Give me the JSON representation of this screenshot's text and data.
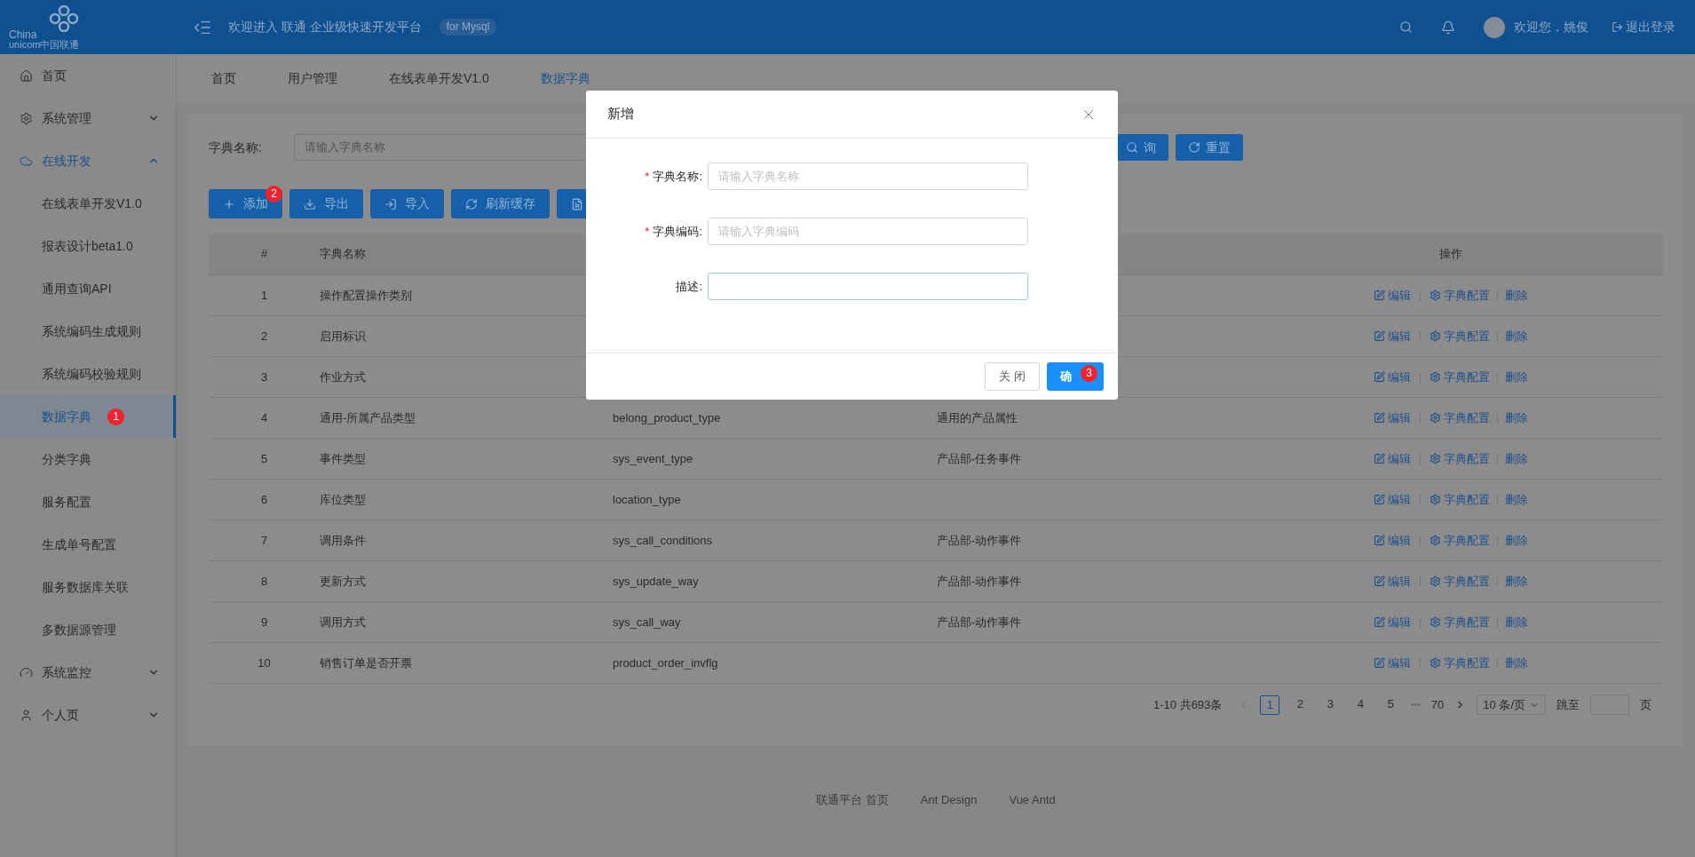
{
  "header": {
    "logo_lines": [
      "China",
      "unicom中国联通"
    ],
    "title": "欢迎进入 联通 企业级快速开发平台",
    "tag": "for Mysql",
    "greeting": "欢迎您，姚俊",
    "logout": "退出登录"
  },
  "sidebar": {
    "items": [
      {
        "label": "首页",
        "kind": "home",
        "selected": false
      },
      {
        "label": "系统管理",
        "kind": "gear",
        "selected": false,
        "expanded": false
      },
      {
        "label": "在线开发",
        "kind": "cloud",
        "selected": false,
        "expanded": true,
        "children": [
          {
            "label": "在线表单开发V1.0",
            "selected": false
          },
          {
            "label": "报表设计beta1.0",
            "selected": false
          },
          {
            "label": "通用查询API",
            "selected": false
          },
          {
            "label": "系统编码生成规则",
            "selected": false
          },
          {
            "label": "系统编码校验规则",
            "selected": false
          },
          {
            "label": "数据字典",
            "selected": true,
            "badge": "1"
          },
          {
            "label": "分类字典",
            "selected": false
          },
          {
            "label": "服务配置",
            "selected": false
          },
          {
            "label": "生成单号配置",
            "selected": false
          },
          {
            "label": "服务数据库关联",
            "selected": false
          },
          {
            "label": "多数据源管理",
            "selected": false
          }
        ]
      },
      {
        "label": "系统监控",
        "kind": "gauge",
        "selected": false,
        "expanded": false
      },
      {
        "label": "个人页",
        "kind": "user",
        "selected": false,
        "expanded": false
      }
    ]
  },
  "tabs": [
    {
      "label": "首页",
      "selected": false
    },
    {
      "label": "用户管理",
      "selected": false
    },
    {
      "label": "在线表单开发V1.0",
      "selected": false
    },
    {
      "label": "数据字典",
      "selected": true
    }
  ],
  "search": {
    "label": "字典名称:",
    "placeholder": "请输入字典名称",
    "buttons": [
      {
        "label": "询",
        "kind": "search"
      },
      {
        "label": "重置",
        "kind": "reset"
      }
    ]
  },
  "toolbar": [
    {
      "label": "添加",
      "kind": "plus",
      "badge": "2"
    },
    {
      "label": "导出",
      "kind": "export"
    },
    {
      "label": "导入",
      "kind": "import"
    },
    {
      "label": "刷新缓存",
      "kind": "refresh"
    },
    {
      "kind": "doc"
    }
  ],
  "table": {
    "headers": {
      "index": "#",
      "name": "字典名称",
      "actions": "操作"
    },
    "rows": [
      {
        "index": "1",
        "name": "操作配置操作类别",
        "actions": [
          "编辑",
          "字典配置",
          "删除"
        ]
      },
      {
        "index": "2",
        "name": "启用标识",
        "actions": [
          "编辑",
          "字典配置",
          "删除"
        ]
      },
      {
        "index": "3",
        "name": "作业方式",
        "actions": [
          "编辑",
          "字典配置",
          "删除"
        ]
      },
      {
        "index": "4",
        "name": "通用-所属产品类型",
        "code": "belong_product_type",
        "description": "通用的产品属性",
        "actions": [
          "编辑",
          "字典配置",
          "删除"
        ]
      },
      {
        "index": "5",
        "name": "事件类型",
        "code": "sys_event_type",
        "description": "产品部-任务事件",
        "actions": [
          "编辑",
          "字典配置",
          "删除"
        ]
      },
      {
        "index": "6",
        "name": "库位类型",
        "code": "location_type",
        "actions": [
          "编辑",
          "字典配置",
          "删除"
        ]
      },
      {
        "index": "7",
        "name": "调用条件",
        "code": "sys_call_conditions",
        "description": "产品部-动作事件",
        "actions": [
          "编辑",
          "字典配置",
          "删除"
        ]
      },
      {
        "index": "8",
        "name": "更新方式",
        "code": "sys_update_way",
        "description": "产品部-动作事件",
        "actions": [
          "编辑",
          "字典配置",
          "删除"
        ]
      },
      {
        "index": "9",
        "name": "调用方式",
        "code": "sys_call_way",
        "description": "产品部-动作事件",
        "actions": [
          "编辑",
          "字典配置",
          "删除"
        ]
      },
      {
        "index": "10",
        "name": "销售订单是否开票",
        "code": "product_order_invflg",
        "actions": [
          "编辑",
          "字典配置",
          "删除"
        ]
      }
    ]
  },
  "pagination": {
    "summary": "1-10 共693条",
    "pages": [
      {
        "label": "1",
        "selected": true
      },
      {
        "label": "2",
        "selected": false
      },
      {
        "label": "3",
        "selected": false
      },
      {
        "label": "4",
        "selected": false
      },
      {
        "label": "5",
        "selected": false
      }
    ],
    "ellipsis": "•••",
    "last": "70",
    "page_size": "10 条/页",
    "jump_label": "跳至",
    "page_suffix": "页"
  },
  "footer": [
    "联通平台 首页",
    "Ant Design",
    "Vue Antd"
  ],
  "modal": {
    "title": "新增",
    "fields": [
      {
        "label": "字典名称:",
        "required_mark": "*",
        "placeholder": "请输入字典名称",
        "focused": false
      },
      {
        "label": "字典编码:",
        "required_mark": "*",
        "placeholder": "请输入字典编码",
        "focused": false
      },
      {
        "label": "描述:",
        "focused": true
      }
    ],
    "buttons": [
      {
        "label": "关 闭",
        "kind": "default"
      },
      {
        "label": "确",
        "kind": "primary",
        "badge": "3"
      }
    ]
  }
}
